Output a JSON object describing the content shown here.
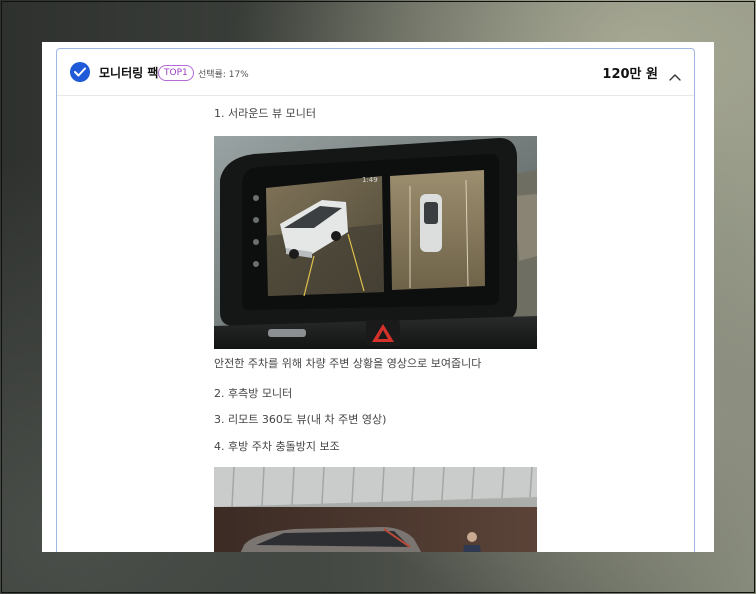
{
  "option": {
    "title": "모니터링 팩",
    "badge": "TOP1",
    "selection_rate": "선택률: 17%",
    "price": "120만 원",
    "checked": true
  },
  "content": {
    "item1": "1. 서라운드 뷰 모니터",
    "item1_desc": "안전한 주차를 위해 차량 주변 상황을 영상으로 보여줍니다",
    "item2": "2. 후측방 모니터",
    "item3": "3. 리모트 360도 뷰(내 차 주변 영상)",
    "item4": "4. 후방 주차 충돌방지 보조",
    "screen_time": "1:49"
  },
  "colors": {
    "accent": "#1f5ad8",
    "badge": "#9b3fc9",
    "card_border": "#9fb7e2"
  },
  "icons": [
    "check-circle-icon",
    "chevron-up-icon",
    "hazard-icon"
  ]
}
